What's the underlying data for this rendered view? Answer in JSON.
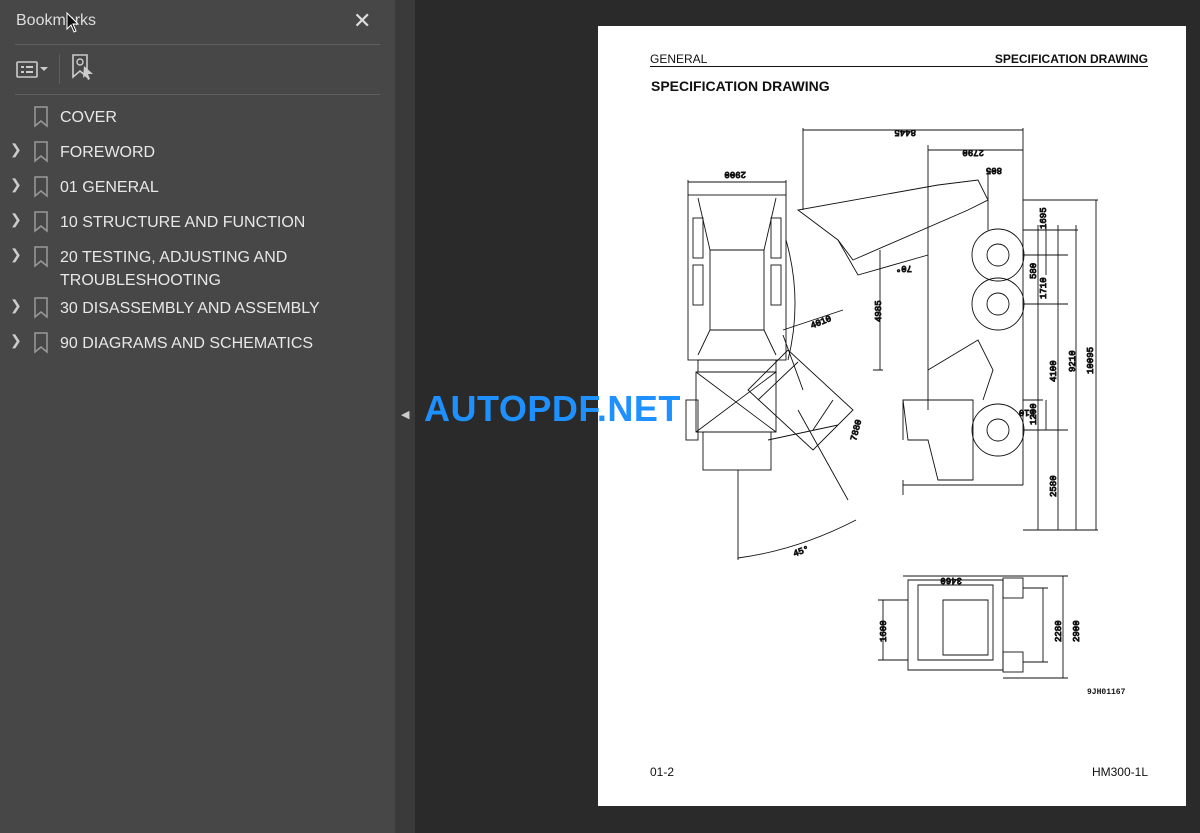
{
  "sidebar": {
    "title": "Bookmarks",
    "close_icon": "close-icon",
    "toolbar": {
      "options_icon": "list-options-icon",
      "find_icon": "find-bookmark-icon"
    },
    "items": [
      {
        "label": "COVER",
        "expandable": false
      },
      {
        "label": "FOREWORD",
        "expandable": true
      },
      {
        "label": "01 GENERAL",
        "expandable": true
      },
      {
        "label": "10 STRUCTURE AND FUNCTION",
        "expandable": true
      },
      {
        "label": "20 TESTING, ADJUSTING AND TROUBLESHOOTING",
        "expandable": true
      },
      {
        "label": "30 DISASSEMBLY AND ASSEMBLY",
        "expandable": true
      },
      {
        "label": "90 DIAGRAMS AND SCHEMATICS",
        "expandable": true
      }
    ]
  },
  "page": {
    "header_left": "GENERAL",
    "header_right": "SPECIFICATION DRAWING",
    "title": "SPECIFICATION DRAWING",
    "footer_left": "01-2",
    "footer_right": "HM300-1L",
    "figure_code": "9JH01167",
    "dimensions": {
      "d8445": "8445",
      "d2790": "2790",
      "d805": "805",
      "d2900top": "2900",
      "d1695": "1695",
      "d580": "580",
      "d1710": "1710",
      "d4985": "4985",
      "d4010": "4010",
      "d9210": "9210",
      "d10095": "10095",
      "d4100": "4100",
      "d510": "510",
      "d1200": "1200",
      "d2580": "2580",
      "d7880": "7880",
      "d45": "45°",
      "d70": "70°",
      "d3460": "3460",
      "d1600": "1600",
      "d2280": "2280",
      "d2900front": "2900"
    }
  },
  "watermark": "AUTOPDF.NET"
}
